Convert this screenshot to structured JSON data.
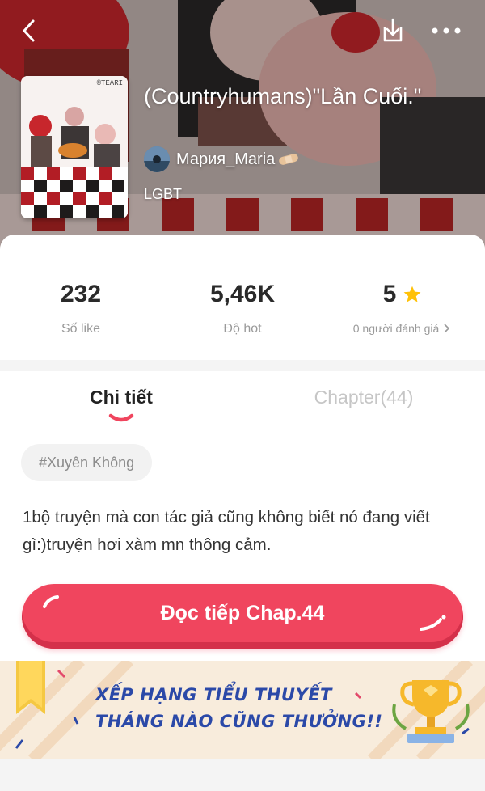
{
  "header": {
    "title": "(Countryhumans)\"Lần Cuối.\"",
    "author": "Мария_Maria",
    "genre": "LGBT",
    "cover_tag": "©TEARI"
  },
  "stats": [
    {
      "value": "232",
      "label": "Số like"
    },
    {
      "value": "5,46K",
      "label": "Độ hot"
    },
    {
      "value": "5",
      "label": "0 người đánh giá"
    }
  ],
  "tabs": [
    {
      "label": "Chi tiết",
      "active": true
    },
    {
      "label": "Chapter(44)",
      "active": false
    }
  ],
  "hashtag": "#Xuyên Không",
  "description": "1bộ truyện mà con tác giả cũng không biết nó đang viết gì:)truyện hơi xàm mn thông cảm.",
  "read_button": "Đọc tiếp Chap.44",
  "banner": {
    "line1": "XẾP HẠNG TIỂU THUYẾT",
    "line2": "THÁNG NÀO CŨNG THƯỞNG!!"
  },
  "icons": {
    "back": "chevron-left-icon",
    "download": "download-icon",
    "more": "more-dots-icon",
    "star": "star-icon",
    "trophy": "trophy-icon",
    "bookmark": "bookmark-ribbon-icon"
  },
  "colors": {
    "accent": "#f0455e",
    "star": "#ffc107",
    "banner_text": "#2b49a8"
  }
}
